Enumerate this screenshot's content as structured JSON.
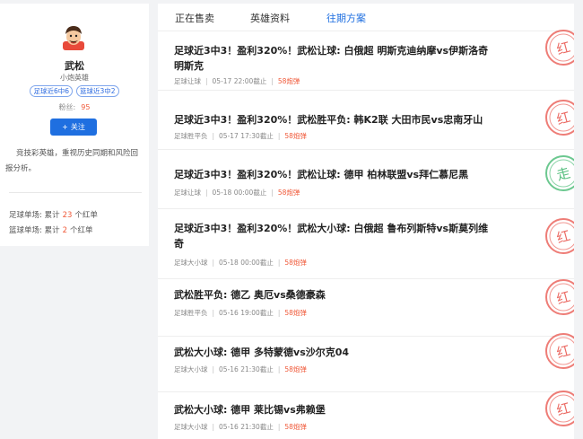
{
  "profile": {
    "name": "武松",
    "title": "小炮英雄",
    "badges": [
      "足球近6中6",
      "篮球近3中2"
    ],
    "fans_label": "粉丝:",
    "fans_count": "95",
    "follow_label": "关注",
    "description": "竞技彩英雄，重视历史同期和风险回报分析。",
    "stats": [
      {
        "prefix": "足球单场:  累计",
        "count": "23",
        "suffix": "个红单"
      },
      {
        "prefix": "篮球单场:  累计",
        "count": "2",
        "suffix": "个红单"
      }
    ]
  },
  "tabs": [
    {
      "label": "正在售卖",
      "active": false
    },
    {
      "label": "英雄资料",
      "active": false
    },
    {
      "label": "往期方案",
      "active": true
    }
  ],
  "items": [
    {
      "title": "足球近3中3！盈利320%！武松让球: 白俄超 明斯克迪纳摩vs伊斯洛奇明斯克",
      "type": "足球让球",
      "time": "05-17 22:00截止",
      "price": "58炮弹",
      "result": "红"
    },
    {
      "title": "足球近3中3！盈利320%！武松胜平负: 韩K2联 大田市民vs忠南牙山",
      "type": "足球胜平负",
      "time": "05-17 17:30截止",
      "price": "58炮弹",
      "result": "红"
    },
    {
      "title": "足球近3中3！盈利320%！武松让球: 德甲 柏林联盟vs拜仁慕尼黑",
      "type": "足球让球",
      "time": "05-18 00:00截止",
      "price": "58炮弹",
      "result": "走"
    },
    {
      "title": "足球近3中3！盈利320%！武松大小球: 白俄超 鲁布列斯特vs斯莫列维奇",
      "type": "足球大小球",
      "time": "05-18 00:00截止",
      "price": "58炮弹",
      "result": "红"
    },
    {
      "title": "武松胜平负: 德乙 奥厄vs桑德豪森",
      "type": "足球胜平负",
      "time": "05-16 19:00截止",
      "price": "58炮弹",
      "result": "红"
    },
    {
      "title": "武松大小球: 德甲 多特蒙德vs沙尔克04",
      "type": "足球大小球",
      "time": "05-16 21:30截止",
      "price": "58炮弹",
      "result": "红"
    },
    {
      "title": "武松大小球: 德甲 莱比锡vs弗赖堡",
      "type": "足球大小球",
      "time": "05-16 21:30截止",
      "price": "58炮弹",
      "result": "红"
    }
  ],
  "colors": {
    "accent": "#1f6fe0",
    "highlight": "#f05a3a",
    "stamp_red": "#e8524a",
    "stamp_green": "#3bb56b"
  }
}
